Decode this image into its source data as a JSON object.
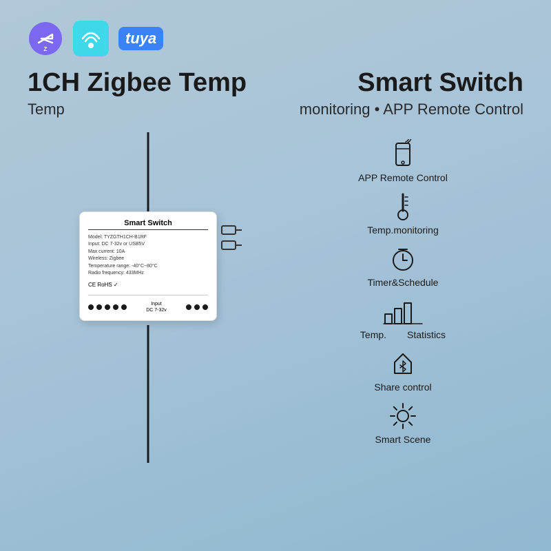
{
  "logos": {
    "zigbee_alt": "Zigbee logo",
    "smartlife_alt": "Smart Life logo",
    "tuya_text": "tuya"
  },
  "header": {
    "title_line1": "1CH Zigbee Temp",
    "title_line2": "Temp",
    "title_right1": "Smart Switch",
    "title_right2": "monitoring • APP Remote Control"
  },
  "device": {
    "label": "Smart Switch",
    "model": "Model: TYZGTH1CH-B1RF",
    "input": "Input: DC 7-32v or USB5V",
    "max_current": "Max current: 10A",
    "wireless": "Wireless: Zigbee",
    "temp_range": "Temperature range: -40°C~80°C",
    "radio_freq": "Radio frequency: 433MHz",
    "certifications": "CE RoHS ✓",
    "input_label": "Input\nDC 7-32v"
  },
  "features": [
    {
      "id": "app-remote",
      "label": "APP Remote Control",
      "icon": "remote-icon"
    },
    {
      "id": "temp-monitoring",
      "label": "Temp.monitoring",
      "icon": "thermometer-icon"
    },
    {
      "id": "timer-schedule",
      "label": "Timer&Schedule",
      "icon": "timer-icon"
    },
    {
      "id": "temp-statistics",
      "label_left": "Temp.",
      "label_right": "Statistics",
      "icon": "chart-icon"
    },
    {
      "id": "share-control",
      "label": "Share control",
      "icon": "bluetooth-icon"
    },
    {
      "id": "smart-scene",
      "label": "Smart Scene",
      "icon": "sun-icon"
    }
  ]
}
